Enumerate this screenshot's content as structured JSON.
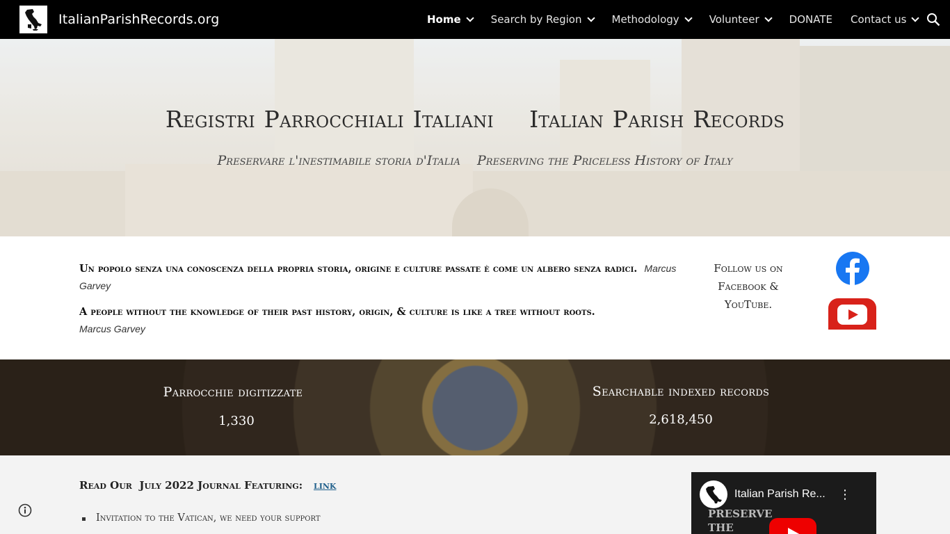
{
  "header": {
    "site_title": "ItalianParishRecords.org",
    "nav": [
      {
        "label": "Home",
        "active": true,
        "dropdown": true
      },
      {
        "label": "Search by Region",
        "active": false,
        "dropdown": true
      },
      {
        "label": "Methodology",
        "active": false,
        "dropdown": true
      },
      {
        "label": "Volunteer",
        "active": false,
        "dropdown": true
      },
      {
        "label": "DONATE",
        "active": false,
        "dropdown": false
      },
      {
        "label": "Contact us",
        "active": false,
        "dropdown": true
      }
    ]
  },
  "hero": {
    "title": "Registri Parrocchiali Italiani    Italian Parish Records",
    "subtitle": "Preservare l'inestimabile storia d'Italia    Preserving the Priceless History of Italy"
  },
  "quotes": {
    "italian": "Un popolo senza una conoscenza della propria storia, origine e culture passate è come un albero senza radici.",
    "italian_author": "Marcus Garvey",
    "english": "A people without the knowledge of their past history, origin, & culture is like a tree without roots.",
    "english_author": "Marcus Garvey"
  },
  "social": {
    "follow_text": "Follow us on Facebook & YouTube."
  },
  "stats": {
    "left_label": "Parrocchie digitizzate",
    "left_value": "1,330",
    "right_label": "Searchable indexed records",
    "right_value": "2,618,450"
  },
  "journal": {
    "text": "Read Our  July 2022 Journal Featuring:",
    "link_text": "link",
    "bullets": [
      "Invitation to the Vatican, we need your support"
    ]
  },
  "video": {
    "title": "Italian Parish Re...",
    "menu": "⋮",
    "bg_text_line1": "PRESERVE",
    "bg_text_line2": "THE"
  },
  "colors": {
    "topbar": "#000000",
    "facebook": "#1877f2",
    "youtube": "#d8221a",
    "link": "#1f5f8b"
  }
}
